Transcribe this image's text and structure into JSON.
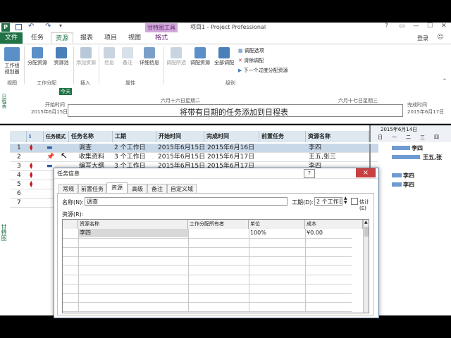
{
  "window": {
    "title": "项目1 - Project Professional",
    "context_tab_group": "甘特图工具",
    "user": "登录"
  },
  "ribbon_tabs": [
    "文件",
    "任务",
    "资源",
    "报表",
    "项目",
    "视图",
    "格式"
  ],
  "ribbon": {
    "buttons": {
      "team_planner": "工作组\n规划器",
      "assign_resources": "分配资源",
      "resource_pool": "资源池",
      "add_resources": "添加资源",
      "info": "信息",
      "notes": "备注",
      "details": "详细信息",
      "level_selection": "调配所选",
      "level_resource": "调配资源",
      "level_all": "全部调配",
      "leveling_options": "调配选项",
      "clear_leveling": "清除调配",
      "next_overallocation": "下一个过度分配资源"
    },
    "groups": {
      "view": "视图",
      "assignments": "工作分配",
      "insert": "插入",
      "properties": "属性",
      "level": "级别"
    }
  },
  "timeline": {
    "side_label": "日程表",
    "today": "今天",
    "start_label": "开始时间",
    "start_date": "2015年6月15日",
    "finish_label": "完成时间",
    "finish_date": "2015年6月17日",
    "tick_left": "六月十六日星期二",
    "tick_right": "六月十七日星期三",
    "placeholder": "将带有日期的任务添加到日程表"
  },
  "gantt_label": "甘特图",
  "grid": {
    "headers": [
      "任务模式",
      "任务名称",
      "工期",
      "开始时间",
      "完成时间",
      "前置任务",
      "资源名称"
    ],
    "info_icon_header": "ℹ",
    "rows": [
      {
        "id": "1",
        "name": "调查",
        "duration": "2 个工作日",
        "start": "2015年6月15日",
        "finish": "2015年6月16日",
        "resource": "李四"
      },
      {
        "id": "2",
        "name": "收集资料",
        "duration": "3 个工作日",
        "start": "2015年6月15日",
        "finish": "2015年6月17日",
        "resource": "王五,张三"
      },
      {
        "id": "3",
        "name": "编写大纲",
        "duration": "3 个工作日",
        "start": "2015年6月15日",
        "finish": "2015年6月17日",
        "resource": "李四"
      },
      {
        "id": "4",
        "name": "",
        "duration": "",
        "start": "",
        "finish": "",
        "resource": ""
      },
      {
        "id": "5",
        "name": "",
        "duration": "",
        "start": "",
        "finish": "",
        "resource": ""
      },
      {
        "id": "6",
        "name": "",
        "duration": "",
        "start": "",
        "finish": "",
        "resource": ""
      },
      {
        "id": "7",
        "name": "",
        "duration": "",
        "start": "",
        "finish": "",
        "resource": ""
      }
    ],
    "chart_header_date": "2015年6月14日",
    "chart_days": [
      "日",
      "一",
      "二",
      "三",
      "四"
    ],
    "bar_labels": [
      "李四",
      "王五,张",
      "李四",
      "李四"
    ]
  },
  "dialog": {
    "title": "任务信息",
    "tabs": [
      "常规",
      "前置任务",
      "资源",
      "高级",
      "备注",
      "自定义域"
    ],
    "name_label": "名称(N):",
    "name_value": "调查",
    "duration_label": "工期(D):",
    "duration_value": "2 个工作日",
    "estimated_label": "估计(E)",
    "resources_label": "资源(R):",
    "columns": [
      "资源名称",
      "工作分配所有者",
      "单位",
      "成本"
    ],
    "resource_rows": [
      {
        "name": "李四",
        "owner": "",
        "units": "100%",
        "cost": "¥0.00"
      }
    ],
    "help_btn": "?",
    "close_btn": "×"
  }
}
